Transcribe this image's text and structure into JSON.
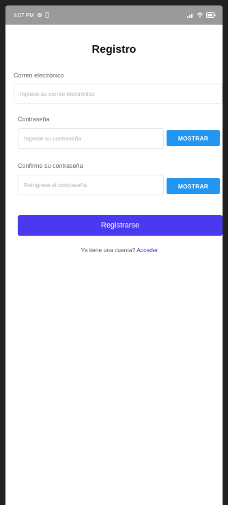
{
  "status_bar": {
    "time": "4:07 PM",
    "icons": [
      "gear-icon",
      "phone-icon",
      "signal-icon",
      "wifi-icon",
      "battery-icon"
    ]
  },
  "page": {
    "title": "Registro"
  },
  "form": {
    "email": {
      "label": "Correo electrónico",
      "placeholder": "Ingrese su correo electrónico",
      "value": ""
    },
    "password": {
      "label": "Contraseña",
      "placeholder": "Ingrese su contraseña",
      "value": "",
      "show_label": "MOSTRAR"
    },
    "confirm_password": {
      "label": "Confirme su contraseña",
      "placeholder": "Reingrese el contraseña",
      "value": "",
      "show_label": "MOSTRAR"
    },
    "submit_label": "Registrarse"
  },
  "login": {
    "prompt": "Ya tiene una cuenta?",
    "link": "Acceder"
  },
  "colors": {
    "primary_button": "#4a3aef",
    "show_button": "#2196f3",
    "link": "#3b2fd6"
  }
}
